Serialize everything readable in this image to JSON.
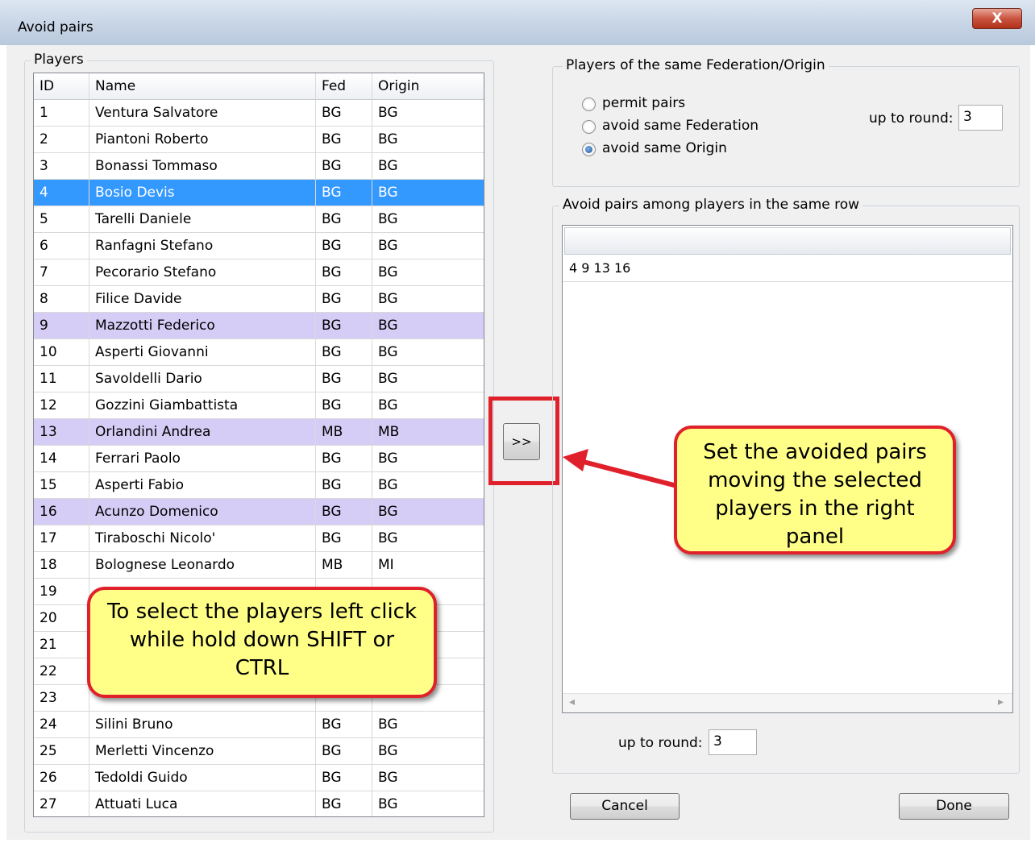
{
  "window": {
    "title": "Avoid pairs",
    "close_glyph": "X"
  },
  "players": {
    "group_label": "Players",
    "columns": [
      "ID",
      "Name",
      "Fed",
      "Origin"
    ],
    "rows": [
      {
        "id": "1",
        "name": "Ventura Salvatore",
        "fed": "BG",
        "origin": "BG",
        "state": "normal"
      },
      {
        "id": "2",
        "name": "Piantoni Roberto",
        "fed": "BG",
        "origin": "BG",
        "state": "normal"
      },
      {
        "id": "3",
        "name": "Bonassi Tommaso",
        "fed": "BG",
        "origin": "BG",
        "state": "normal"
      },
      {
        "id": "4",
        "name": "Bosio Devis",
        "fed": "BG",
        "origin": "BG",
        "state": "selected"
      },
      {
        "id": "5",
        "name": "Tarelli Daniele",
        "fed": "BG",
        "origin": "BG",
        "state": "normal"
      },
      {
        "id": "6",
        "name": "Ranfagni Stefano",
        "fed": "BG",
        "origin": "BG",
        "state": "normal"
      },
      {
        "id": "7",
        "name": "Pecorario Stefano",
        "fed": "BG",
        "origin": "BG",
        "state": "normal"
      },
      {
        "id": "8",
        "name": "Filice Davide",
        "fed": "BG",
        "origin": "BG",
        "state": "normal"
      },
      {
        "id": "9",
        "name": "Mazzotti Federico",
        "fed": "BG",
        "origin": "BG",
        "state": "highlighted"
      },
      {
        "id": "10",
        "name": "Asperti Giovanni",
        "fed": "BG",
        "origin": "BG",
        "state": "normal"
      },
      {
        "id": "11",
        "name": "Savoldelli Dario",
        "fed": "BG",
        "origin": "BG",
        "state": "normal"
      },
      {
        "id": "12",
        "name": "Gozzini Giambattista",
        "fed": "BG",
        "origin": "BG",
        "state": "normal"
      },
      {
        "id": "13",
        "name": "Orlandini Andrea",
        "fed": "MB",
        "origin": "MB",
        "state": "highlighted"
      },
      {
        "id": "14",
        "name": "Ferrari Paolo",
        "fed": "BG",
        "origin": "BG",
        "state": "normal"
      },
      {
        "id": "15",
        "name": "Asperti Fabio",
        "fed": "BG",
        "origin": "BG",
        "state": "normal"
      },
      {
        "id": "16",
        "name": "Acunzo Domenico",
        "fed": "BG",
        "origin": "BG",
        "state": "highlighted"
      },
      {
        "id": "17",
        "name": "Tiraboschi Nicolo'",
        "fed": "BG",
        "origin": "BG",
        "state": "normal"
      },
      {
        "id": "18",
        "name": "Bolognese Leonardo",
        "fed": "MB",
        "origin": "MI",
        "state": "normal"
      },
      {
        "id": "19",
        "name": "",
        "fed": "",
        "origin": "",
        "state": "normal"
      },
      {
        "id": "20",
        "name": "",
        "fed": "",
        "origin": "",
        "state": "normal"
      },
      {
        "id": "21",
        "name": "",
        "fed": "",
        "origin": "",
        "state": "normal"
      },
      {
        "id": "22",
        "name": "",
        "fed": "",
        "origin": "",
        "state": "normal"
      },
      {
        "id": "23",
        "name": "",
        "fed": "",
        "origin": "",
        "state": "normal"
      },
      {
        "id": "24",
        "name": "Silini Bruno",
        "fed": "BG",
        "origin": "BG",
        "state": "normal"
      },
      {
        "id": "25",
        "name": "Merletti Vincenzo",
        "fed": "BG",
        "origin": "BG",
        "state": "normal"
      },
      {
        "id": "26",
        "name": "Tedoldi Guido",
        "fed": "BG",
        "origin": "BG",
        "state": "normal"
      },
      {
        "id": "27",
        "name": "Attuati Luca",
        "fed": "BG",
        "origin": "BG",
        "state": "normal"
      }
    ]
  },
  "move_button_label": ">>",
  "federation_group": {
    "label": "Players of the same Federation/Origin",
    "options": [
      "permit pairs",
      "avoid same Federation",
      "avoid same Origin"
    ],
    "selected_option": "avoid same Origin",
    "up_to_round_label": "up to round:",
    "up_to_round_value": "3"
  },
  "avoid_pairs_group": {
    "label": "Avoid pairs among players in the same row",
    "rows": [
      "4 9 13 16"
    ],
    "up_to_round_label": "up to round:",
    "up_to_round_value": "3"
  },
  "buttons": {
    "cancel": "Cancel",
    "done": "Done"
  },
  "callouts": {
    "right": "Set the avoided pairs moving the selected players in the right panel",
    "left": "To select the players left click while hold down SHIFT or CTRL"
  },
  "colors": {
    "selected_row": "#3399ff",
    "highlighted_row": "#d6cdf6",
    "callout_fill": "#ffff88",
    "callout_border": "#e0202a"
  }
}
